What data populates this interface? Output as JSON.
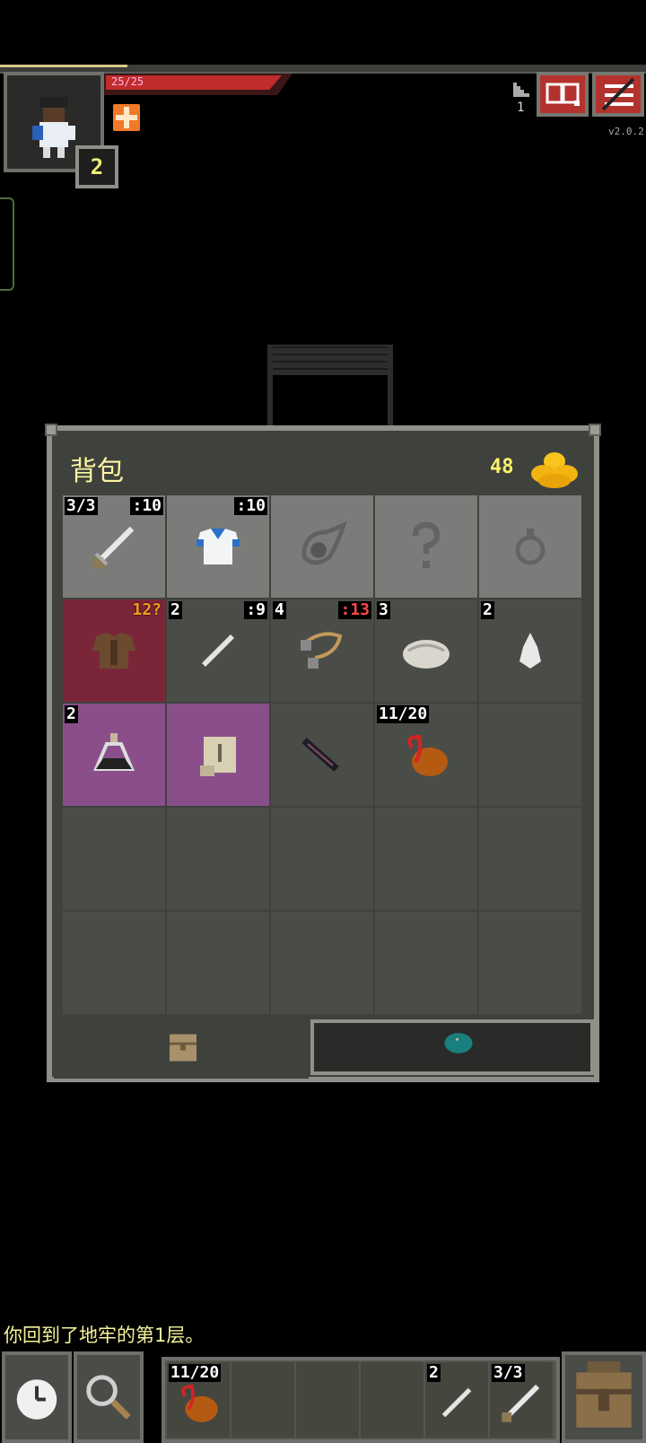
{
  "hud": {
    "hp_text": "25/25",
    "hero_level": "2",
    "depth": "1",
    "version": "v2.0.2",
    "buff_icon": "bless-buff-icon",
    "journal_icon": "journal-icon",
    "menu_icon": "menu-icon"
  },
  "backpack": {
    "title": "背包",
    "gold": "48",
    "equipped": [
      {
        "name": "shortsword",
        "tl": "3/3",
        "tr": ":10"
      },
      {
        "name": "cloth-armor",
        "tl": "",
        "tr": ":10"
      },
      {
        "name": "artifact-slot-empty",
        "tl": "",
        "tr": ""
      },
      {
        "name": "misc-slot-empty",
        "tl": "",
        "tr": ""
      },
      {
        "name": "ring-slot-empty",
        "tl": "",
        "tr": ""
      }
    ],
    "row2": [
      {
        "name": "leather-armor",
        "tl": "",
        "tr": "12?",
        "tr_color": "orange"
      },
      {
        "name": "darts",
        "tl": "2",
        "tr": ":9"
      },
      {
        "name": "bolas",
        "tl": "4",
        "tr": ":13",
        "tr_color": "red"
      },
      {
        "name": "ration",
        "tl": "3",
        "tr": ""
      },
      {
        "name": "stone",
        "tl": "2",
        "tr": ""
      }
    ],
    "row3": [
      {
        "name": "potion",
        "tl": "2",
        "tr": ""
      },
      {
        "name": "scroll",
        "tl": "",
        "tr": ""
      },
      {
        "name": "dagger",
        "tl": "",
        "tr": ""
      },
      {
        "name": "waterskin",
        "tl": "11/20",
        "tr": ""
      },
      {
        "name": "empty",
        "tl": "",
        "tr": ""
      }
    ]
  },
  "log": {
    "message": "你回到了地牢的第1层。"
  },
  "toolbar": {
    "wait_icon": "clock-icon",
    "search_icon": "magnifier-icon",
    "quickslots": [
      {
        "name": "waterskin",
        "label": "11/20"
      },
      {
        "name": "empty",
        "label": ""
      },
      {
        "name": "empty",
        "label": ""
      },
      {
        "name": "empty",
        "label": ""
      },
      {
        "name": "darts",
        "label": "2"
      },
      {
        "name": "shortsword",
        "label": "3/3"
      }
    ],
    "inventory_icon": "backpack-icon"
  },
  "colors": {
    "hp": "#c22b2b",
    "gold": "#fbf36a",
    "title": "#fcf6a4",
    "unidentified": "#f79a1e",
    "warning": "#ff4a4a"
  }
}
